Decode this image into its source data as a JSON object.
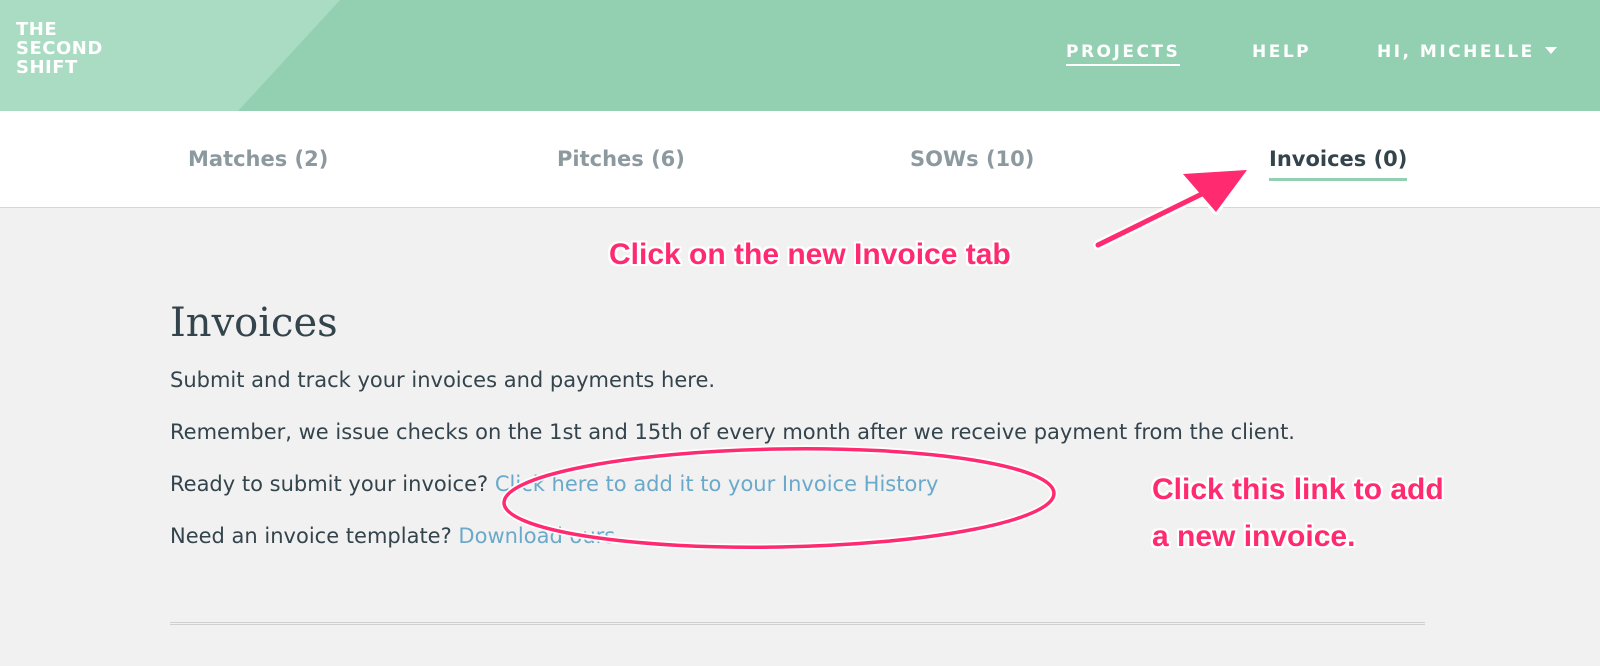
{
  "header": {
    "logo_lines": [
      "THE",
      "SECOND",
      "SHIFT"
    ],
    "nav": {
      "projects": "PROJECTS",
      "help": "HELP",
      "user": "HI, MICHELLE"
    }
  },
  "tabs": {
    "matches": "Matches (2)",
    "pitches": "Pitches (6)",
    "sows": "SOWs (10)",
    "invoices": "Invoices (0)",
    "active": "invoices"
  },
  "main": {
    "title": "Invoices",
    "intro": "Submit and track your invoices and payments here.",
    "reminder": "Remember, we issue checks on the 1st and 15th of every month after we receive payment from the client.",
    "ready_text": "Ready to submit your invoice? ",
    "ready_link": "Click here to add it to your Invoice History",
    "template_text": "Need an invoice template? ",
    "template_link": "Download ours"
  },
  "annotations": {
    "tab_callout": "Click on the new Invoice tab",
    "link_callout_line1": "Click this link to add",
    "link_callout_line2": "a new invoice."
  },
  "colors": {
    "header_green": "#93d0b2",
    "link_blue": "#6aa9c9",
    "annotation_pink": "#ff2a6f",
    "text_dark": "#34444c"
  },
  "icons": {
    "user_menu": "caret-down-icon"
  }
}
